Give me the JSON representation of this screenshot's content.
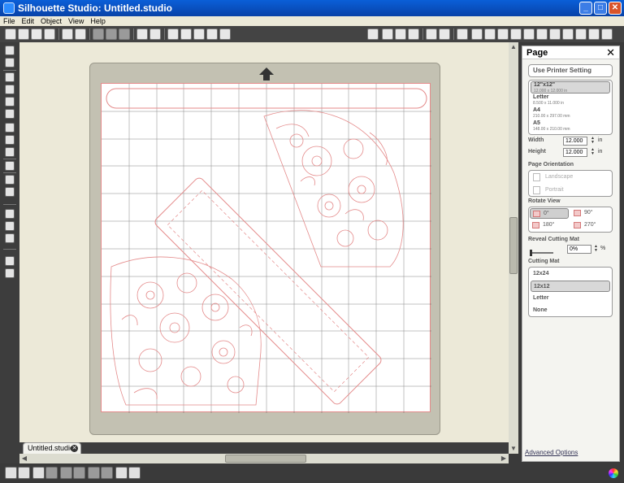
{
  "window": {
    "title": "Silhouette Studio: Untitled.studio",
    "controls": [
      "_",
      "□",
      "✕"
    ]
  },
  "menu": [
    "File",
    "Edit",
    "Object",
    "View",
    "Help"
  ],
  "toolbar": {
    "left_icons": [
      "new-document-icon",
      "open-icon",
      "save-icon",
      "save-as-icon",
      "print-icon",
      "print-cut-icon",
      "cut-icon",
      "copy-icon",
      "paste-icon",
      "undo-icon",
      "redo-icon",
      "zoom-in-icon",
      "zoom-out-icon",
      "zoom-select-icon",
      "pan-icon",
      "fit-page-icon"
    ],
    "right_icons": [
      "lock-icon",
      "grid-icon",
      "registration-icon",
      "page-setup-icon",
      "line-style-icon",
      "fill-pattern-icon",
      "text-icon",
      "replicate-icon",
      "offset-icon",
      "trace-icon",
      "library-icon",
      "store-icon",
      "send-icon"
    ]
  },
  "left_tools": [
    "select-tool",
    "point-edit-tool",
    "line-tool",
    "rectangle-tool",
    "rounded-rect-tool",
    "ellipse-tool",
    "polygon-tool",
    "curve-tool",
    "freehand-tool",
    "text-tool",
    "eraser-tool",
    "knife-tool",
    "view-tool",
    "library-tool",
    "link-tool"
  ],
  "document_tab": {
    "label": "Untitled.studio",
    "close": "✕"
  },
  "panel": {
    "title": "Page",
    "close": "✕",
    "printer_button": "Use Printer Setting",
    "sizes": [
      {
        "name": "12\"x12\"",
        "dims": "12.000 x 12.000 in",
        "selected": true
      },
      {
        "name": "Letter",
        "dims": "8.500 x 11.000 in",
        "selected": false
      },
      {
        "name": "A4",
        "dims": "210.00 x 297.00 mm",
        "selected": false
      },
      {
        "name": "A5",
        "dims": "148.00 x 210.00 mm",
        "selected": false
      }
    ],
    "width_label": "Width",
    "width_value": "12.000",
    "height_label": "Height",
    "height_value": "12.000",
    "unit": "in",
    "orientation_label": "Page Orientation",
    "orientations": [
      "Landscape",
      "Portrait"
    ],
    "rotate_label": "Rotate View",
    "rotations": [
      "0°",
      "90°",
      "180°",
      "270°"
    ],
    "rotation_selected": "0°",
    "reveal_label": "Reveal Cutting Mat",
    "reveal_value": "0%",
    "reveal_unit": "%",
    "mat_label": "Cutting Mat",
    "mats": [
      {
        "name": "12x24",
        "selected": false
      },
      {
        "name": "12x12",
        "selected": true
      },
      {
        "name": "Letter",
        "selected": false
      },
      {
        "name": "None",
        "selected": false
      }
    ],
    "advanced_link": "Advanced Options"
  },
  "colors": {
    "cut_line": "#e48a8a",
    "mat": "#c3c1b2",
    "accent": "#0a5fd8"
  }
}
